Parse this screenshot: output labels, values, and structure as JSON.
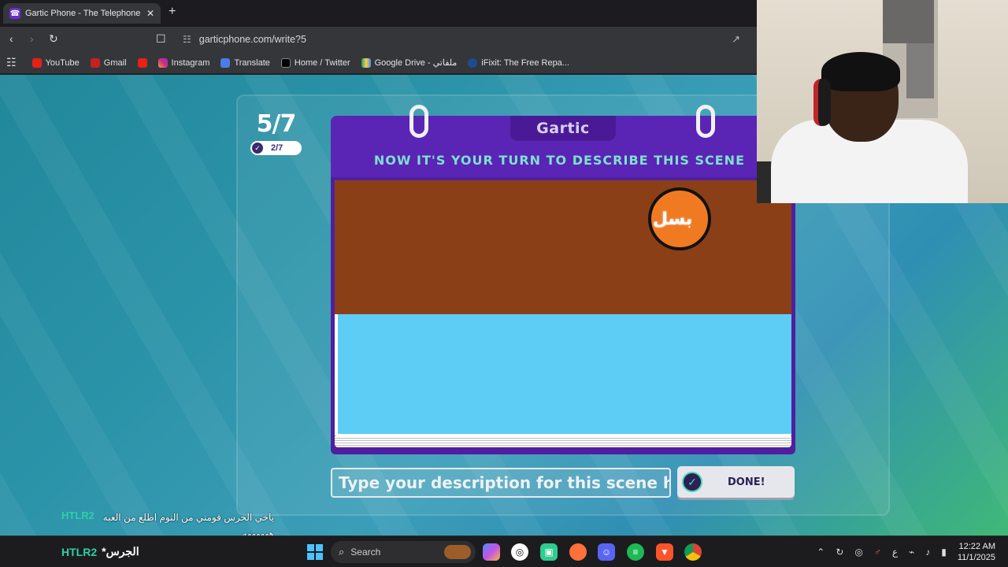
{
  "browser": {
    "tab_title": "Gartic Phone - The Telephone Ga",
    "tab_close": "✕",
    "new_tab": "+",
    "url": "garticphone.com/write?5",
    "bookmarks": [
      "YouTube",
      "Gmail",
      "",
      "Instagram",
      "Translate",
      "Home / Twitter",
      "Google Drive - ملفاتي",
      "iFixit: The Free Repa..."
    ]
  },
  "game": {
    "round": "5/7",
    "done_count": "2/7",
    "logo": "Gartic",
    "headline": "NOW IT'S YOUR TURN TO DESCRIBE THIS SCENE",
    "scene_text": "بسل",
    "input_placeholder": "Type your description for this scene here...",
    "done_label": "DONE!"
  },
  "stream": {
    "chat_user": "HTLR2",
    "chat_message": "ياخي الحرس قومني من النوم اطلع من العبه ههههههه",
    "bar_user": "HTLR2",
    "bar_text": "*الجرس"
  },
  "taskbar": {
    "search_label": "Search",
    "time": "12:22 AM",
    "date": "11/1/2025",
    "lang": "ع"
  },
  "colors": {
    "accent_purple": "#5a25b5",
    "headline_teal": "#7ee0d1",
    "scene_brown": "#8b3f16",
    "scene_blue": "#5ecdf6",
    "sun_orange": "#f07a22",
    "chat_green": "#2ed1a6"
  }
}
